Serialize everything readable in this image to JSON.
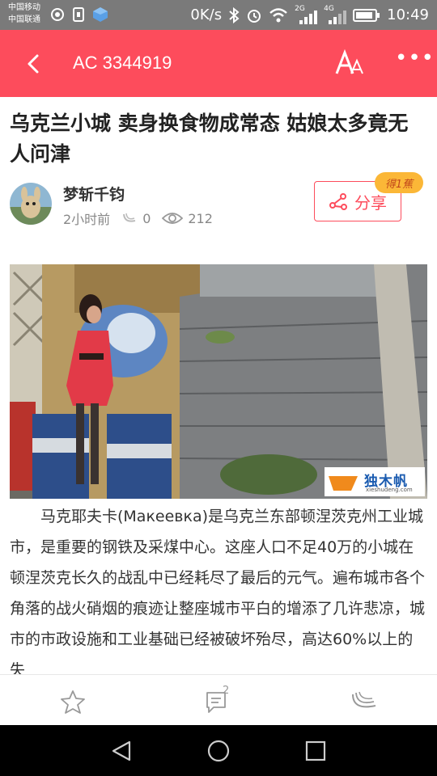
{
  "status_bar": {
    "carrier_1": "中国移动",
    "carrier_2": "中国联通",
    "net_speed": "0K/s",
    "signal_1": "2G",
    "signal_2": "4G",
    "time": "10:49"
  },
  "app_bar": {
    "title": "AC 3344919",
    "icons": [
      "back-arrow-icon",
      "font-size-icon",
      "more-icon"
    ]
  },
  "article": {
    "title": "乌克兰小城 卖身换食物成常态 姑娘太多竟无人问津",
    "author": "梦斩千钧",
    "time": "2小时前",
    "banana_count": "0",
    "view_count": "212",
    "share_label": "分享",
    "badge": "得1蕉",
    "watermark_name": "独木帆",
    "watermark_url": "xieshudeng.com",
    "body": "马克耶夫卡(Макеевка)是乌克兰东部顿涅茨克州工业城市，是重要的钢铁及采煤中心。这座人口不足40万的小城在顿涅茨克长久的战乱中已经耗尽了最后的元气。遍布城市各个角落的战火硝烟的痕迹让整座城市平白的增添了几许悲凉，城市的市政设施和工业基础已经被破坏殆尽，高达60%以上的失"
  },
  "bottom_bar": {
    "comment_count": "2",
    "icons": [
      "star-icon",
      "comment-icon",
      "banana-icon"
    ]
  },
  "colors": {
    "accent": "#fd4c5c",
    "badge": "#fbb737"
  }
}
